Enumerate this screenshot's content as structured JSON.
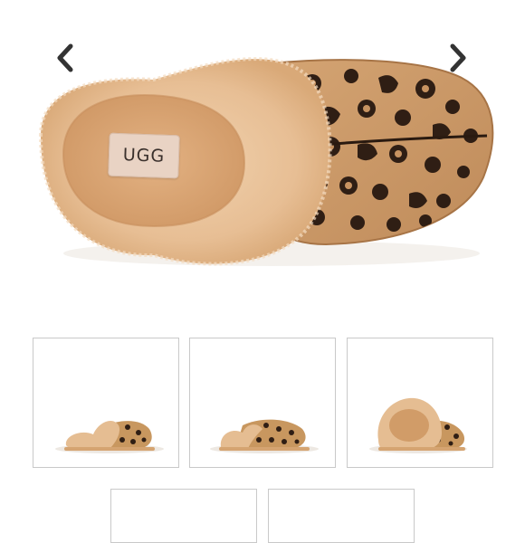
{
  "gallery": {
    "brand_tag": "UGG",
    "prev_icon": "chevron-left-icon",
    "next_icon": "chevron-right-icon",
    "thumbnails": [
      {
        "view": "side-left"
      },
      {
        "view": "side-right"
      },
      {
        "view": "three-quarter"
      },
      {
        "view": "partial"
      },
      {
        "view": "partial"
      }
    ]
  },
  "colors": {
    "fleece": "#e8c39c",
    "leopard_base": "#c99868",
    "leopard_spot": "#2f1e14",
    "arrow": "#333333",
    "thumb_border": "#c9c9c9"
  }
}
